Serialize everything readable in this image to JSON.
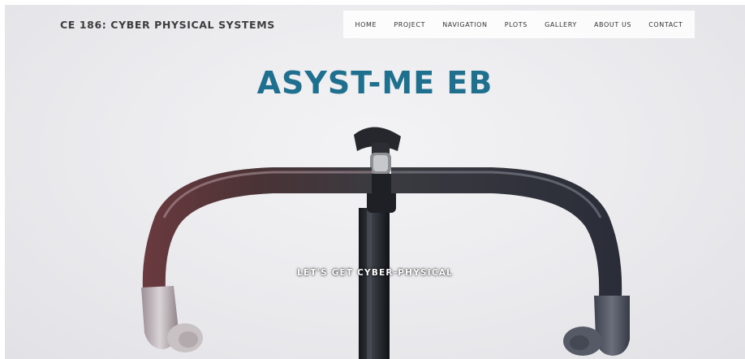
{
  "brand": {
    "title": "CE 186: CYBER PHYSICAL SYSTEMS"
  },
  "nav": {
    "items": [
      {
        "label": "HOME"
      },
      {
        "label": "PROJECT"
      },
      {
        "label": "NAVIGATION"
      },
      {
        "label": "PLOTS"
      },
      {
        "label": "GALLERY"
      },
      {
        "label": "ABOUT US"
      },
      {
        "label": "CONTACT"
      }
    ]
  },
  "hero": {
    "headline": "ASYST-ME EB",
    "tagline": "LET'S GET CYBER-PHYSICAL",
    "image_icon": "bicycle-handlebar-image"
  },
  "colors": {
    "headline": "#1f6f8f",
    "brand_text": "#3d3d3d",
    "nav_text": "#333333",
    "background": "#ececef"
  }
}
